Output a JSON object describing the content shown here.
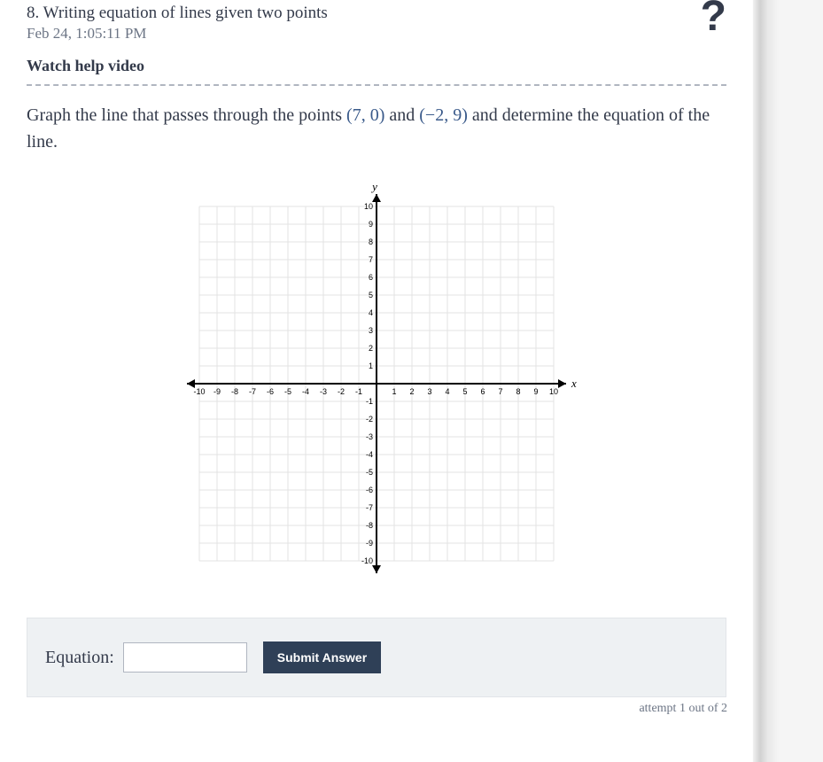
{
  "header": {
    "title": "8. Writing equation of lines given two points",
    "timestamp": "Feb 24, 1:05:11 PM",
    "watch_link": "Watch help video",
    "help_icon": "?"
  },
  "question": {
    "prefix": "Graph the line that passes through the points ",
    "point1": "(7, 0)",
    "mid": " and ",
    "point2": "(−2, 9)",
    "suffix": " and determine the equation of the line."
  },
  "chart_data": {
    "type": "scatter",
    "title": "",
    "xlabel": "x",
    "ylabel": "y",
    "xlim": [
      -10,
      10
    ],
    "ylim": [
      -10,
      10
    ],
    "xticks": [
      -10,
      -9,
      -8,
      -7,
      -6,
      -5,
      -4,
      -3,
      -2,
      -1,
      1,
      2,
      3,
      4,
      5,
      6,
      7,
      8,
      9,
      10
    ],
    "yticks": [
      -10,
      -9,
      -8,
      -7,
      -6,
      -5,
      -4,
      -3,
      -2,
      -1,
      1,
      2,
      3,
      4,
      5,
      6,
      7,
      8,
      9,
      10
    ],
    "series": []
  },
  "answer": {
    "label": "Equation:",
    "value": "",
    "placeholder": "",
    "submit_label": "Submit Answer",
    "attempt_text": "attempt 1 out of 2"
  }
}
